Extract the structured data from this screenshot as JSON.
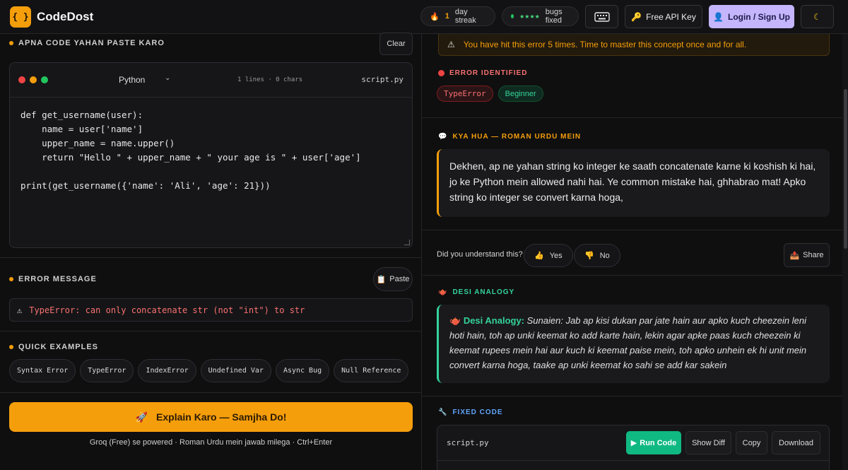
{
  "app": {
    "logo_mark": "{ }",
    "name": "CodeDost"
  },
  "header": {
    "streak_icon": "fire-icon",
    "streak_count": "1",
    "streak_label": "day streak",
    "bugs_stars": "★★★★",
    "bugs_label": "bugs fixed",
    "keyboard_icon": "keyboard-icon",
    "api_icon": "key-icon",
    "api_label": "Free API Key",
    "login_icon": "user-icon",
    "login_label": "Login / Sign Up",
    "theme_icon": "moon-icon"
  },
  "editor_section": {
    "title": "APNA CODE YAHAN PASTE KARO",
    "clear_label": "Clear",
    "language": "Python",
    "meta": "1 lines · 0 chars",
    "filename": "script.py",
    "code": "def get_username(user):\n    name = user['name']\n    upper_name = name.upper()\n    return \"Hello \" + upper_name + \" your age is \" + user['age']\n\nprint(get_username({'name': 'Ali', 'age': 21}))"
  },
  "error_section": {
    "title": "ERROR MESSAGE",
    "paste_label": "Paste",
    "error_text": "TypeError: can only concatenate str (not \"int\") to str"
  },
  "examples_section": {
    "title": "QUICK EXAMPLES",
    "items": [
      "Syntax Error",
      "TypeError",
      "IndexError",
      "Undefined Var",
      "Async Bug",
      "Null Reference"
    ]
  },
  "explain": {
    "icon": "rocket-icon",
    "label": "Explain Karo — Samjha Do!",
    "note": "Groq (Free) se powered · Roman Urdu mein jawab milega · Ctrl+Enter"
  },
  "result": {
    "notice": "You have hit this error 5 times. Time to master this concept once and for all.",
    "error_identified_title": "ERROR IDENTIFIED",
    "error_type": "TypeError",
    "level": "Beginner",
    "kya_hua_title": "KYA HUA — ROMAN URDU MEIN",
    "explanation": "Dekhen, ap ne yahan string ko integer ke saath concatenate karne ki koshish ki hai, jo ke Python mein allowed nahi hai. Ye common mistake hai, ghhabrao mat! Apko string ko integer se convert karna hoga,",
    "understand_q": "Did you understand this?",
    "yes_label": "Yes",
    "no_label": "No",
    "share_label": "Share",
    "analogy_title": "DESI ANALOGY",
    "analogy_head": "Desi Analogy:",
    "analogy_text": "Sunaien: Jab ap kisi dukan par jate hain aur apko kuch cheezein leni hoti hain, toh ap unki keemat ko add karte hain, lekin agar apke paas kuch cheezein ki keemat rupees mein hai aur kuch ki keemat paise mein, toh apko unhein ek hi unit mein convert karna hoga, taake ap unki keemat ko sahi se add kar sakein",
    "fixed_code_title": "FIXED CODE",
    "fixed_filename": "script.py",
    "run_label": "Run Code",
    "diff_label": "Show Diff",
    "copy_label": "Copy",
    "download_label": "Download"
  },
  "colors": {
    "accent": "#f59e0b",
    "success": "#10b981",
    "error": "#f87171",
    "login": "#c4b5fd"
  }
}
